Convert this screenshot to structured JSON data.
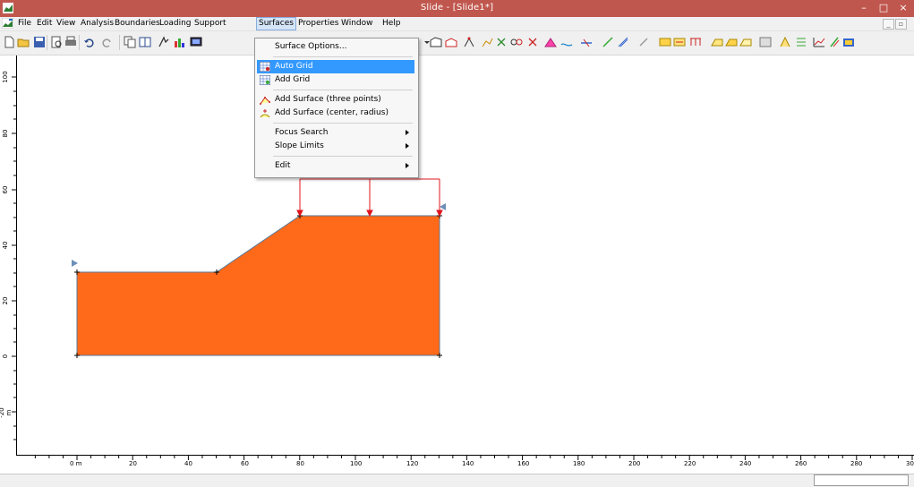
{
  "window": {
    "title": "Slide - [Slide1*]",
    "controls": {
      "minimize": "–",
      "maximize": "□",
      "close": "×"
    }
  },
  "menubar": {
    "items": [
      "File",
      "Edit",
      "View",
      "Analysis",
      "Boundaries",
      "Loading",
      "Support",
      "Surfaces",
      "Properties",
      "Window",
      "Help"
    ],
    "active": "Surfaces",
    "mdi_controls": {
      "minimize": "_",
      "restore": "▫"
    }
  },
  "surfaces_menu": {
    "items": [
      {
        "label": "Surface Options...",
        "icon": ""
      },
      {
        "label": "Auto Grid",
        "icon": "auto-grid-icon",
        "highlighted": true
      },
      {
        "label": "Add Grid",
        "icon": "add-grid-icon"
      },
      {
        "label": "Add Surface (three points)",
        "icon": "three-points-icon"
      },
      {
        "label": "Add Surface (center, radius)",
        "icon": "center-radius-icon"
      },
      {
        "label": "Focus Search",
        "submenu": true
      },
      {
        "label": "Slope Limits",
        "submenu": true
      },
      {
        "label": "Edit",
        "submenu": true
      }
    ]
  },
  "rulers": {
    "x_labels": [
      "0 m",
      "20",
      "40",
      "60",
      "80",
      "100",
      "120",
      "140",
      "160",
      "180",
      "200",
      "220",
      "240",
      "260",
      "280",
      "30"
    ],
    "y_labels": [
      "100",
      "80",
      "60",
      "40",
      "20",
      "0",
      "-20 m"
    ]
  },
  "colors": {
    "titlebar": "#c0574e",
    "slope_fill": "#ff6a1a",
    "load_arrows": "#e0141e",
    "menu_highlight": "#3399ff"
  }
}
